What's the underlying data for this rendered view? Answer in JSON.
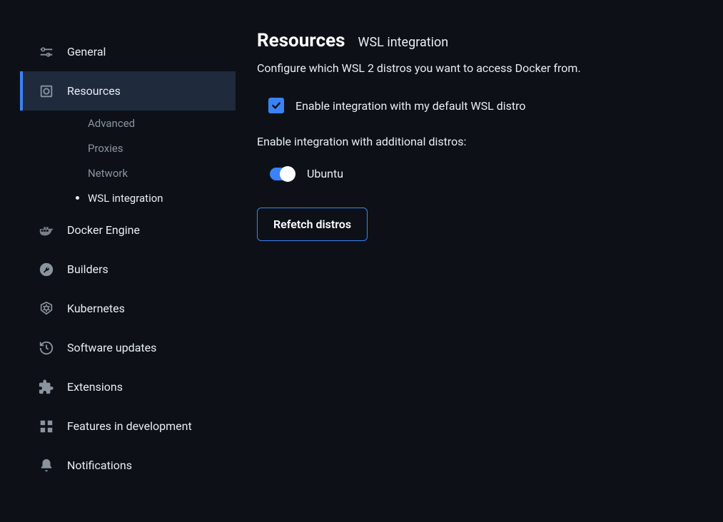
{
  "sidebar": {
    "items": [
      {
        "label": "General"
      },
      {
        "label": "Resources",
        "active": true,
        "subitems": [
          {
            "label": "Advanced"
          },
          {
            "label": "Proxies"
          },
          {
            "label": "Network"
          },
          {
            "label": "WSL integration",
            "active": true
          }
        ]
      },
      {
        "label": "Docker Engine"
      },
      {
        "label": "Builders"
      },
      {
        "label": "Kubernetes"
      },
      {
        "label": "Software updates"
      },
      {
        "label": "Extensions"
      },
      {
        "label": "Features in development"
      },
      {
        "label": "Notifications"
      }
    ]
  },
  "main": {
    "title": "Resources",
    "subtitle": "WSL integration",
    "description": "Configure which WSL 2 distros you want to access Docker from.",
    "checkbox_label": "Enable integration with my default WSL distro",
    "checkbox_checked": true,
    "additional_text": "Enable integration with additional distros:",
    "distros": [
      {
        "name": "Ubuntu",
        "enabled": true
      }
    ],
    "refetch_label": "Refetch distros"
  },
  "colors": {
    "accent": "#3b82f6",
    "bg": "#0d1117",
    "active_bg": "#1f2a3d"
  }
}
